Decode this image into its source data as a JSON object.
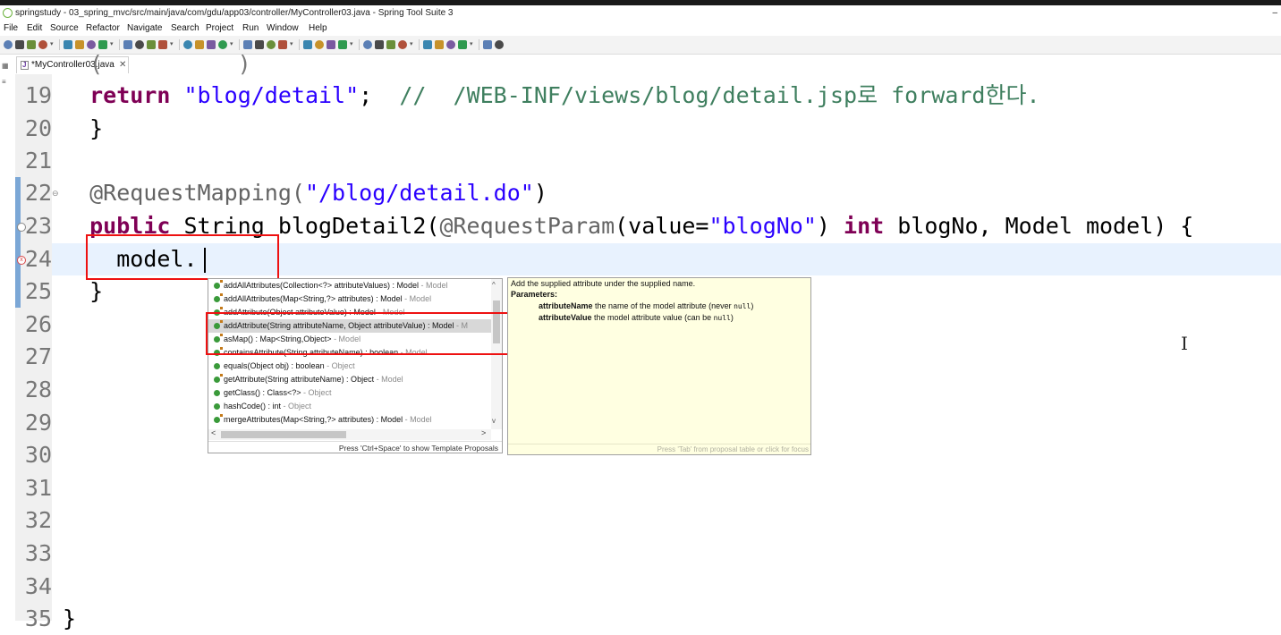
{
  "window": {
    "title": "springstudy - 03_spring_mvc/src/main/java/com/gdu/app03/controller/MyController03.java - Spring Tool Suite 3",
    "minimize": "–"
  },
  "menu": [
    "File",
    "Edit",
    "Source",
    "Refactor",
    "Navigate",
    "Search",
    "Project",
    "Run",
    "Window",
    "Help"
  ],
  "toolbar_icons": [
    "new-icon",
    "save-icon",
    "save-all-icon",
    "print-icon",
    "toggle-icon",
    "select-icon",
    "debug-icon",
    "refresh-icon",
    "pin-icon",
    "highlight-icon",
    "block-icon",
    "list-icon",
    "pilcrow-icon",
    "arrows-icon",
    "bug-icon",
    "run-icon",
    "run-config-icon",
    "stop-icon",
    "deploy-icon",
    "search-icon",
    "tasks-icon",
    "gear-icon",
    "open-folder-icon",
    "build-icon",
    "brush-icon",
    "marker-icon",
    "globe-icon",
    "down-icon",
    "up-icon",
    "back-icon",
    "forward-icon",
    "nav-back-icon",
    "nav-forward-icon",
    "pin-editor-icon"
  ],
  "editor_tab": {
    "label": "*MyController03.java",
    "close": "✕"
  },
  "editor": {
    "line_numbers": [
      "19",
      "20",
      "21",
      "22",
      "23",
      "24",
      "25",
      "26",
      "27",
      "28",
      "29",
      "30",
      "31",
      "32",
      "33",
      "34",
      "35"
    ],
    "partial_top_line": "(          )",
    "line19": {
      "kw": "return",
      "str": "\"blog/detail\"",
      "sep": ";",
      "cmt": "//  /WEB-INF/views/blog/detail.jsp로 forward한다."
    },
    "line20": "}",
    "line22": {
      "ann": "@RequestMapping(",
      "str": "\"/blog/detail.do\"",
      "end": ")"
    },
    "line23": {
      "kw": "public",
      "t1": " String blogDetail2(",
      "ann": "@RequestParam",
      "t2": "(value=",
      "str": "\"blogNo\"",
      "t3": ") ",
      "kw2": "int",
      "t4": " blogNo, Model model) {"
    },
    "line24": "model.",
    "line25": "}",
    "line35": "}"
  },
  "proposals": {
    "items": [
      {
        "text": "addAllAttributes(Collection<?> attributeValues) : Model",
        "owner": " - Model",
        "selected": false
      },
      {
        "text": "addAllAttributes(Map<String,?> attributes) : Model",
        "owner": " - Model",
        "selected": false
      },
      {
        "text": "addAttribute(Object attributeValue) : Model",
        "owner": " - Model",
        "selected": false
      },
      {
        "text": "addAttribute(String attributeName, Object attributeValue) : Model",
        "owner": " - M",
        "selected": true
      },
      {
        "text": "asMap() : Map<String,Object>",
        "owner": " - Model",
        "selected": false
      },
      {
        "text": "containsAttribute(String attributeName) : boolean",
        "owner": " - Model",
        "selected": false
      },
      {
        "text": "equals(Object obj) : boolean",
        "owner": " - Object",
        "selected": false
      },
      {
        "text": "getAttribute(String attributeName) : Object",
        "owner": " - Model",
        "selected": false
      },
      {
        "text": "getClass() : Class<?>",
        "owner": " - Object",
        "selected": false
      },
      {
        "text": "hashCode() : int",
        "owner": " - Object",
        "selected": false
      },
      {
        "text": "mergeAttributes(Map<String,?> attributes) : Model",
        "owner": " - Model",
        "selected": false
      }
    ],
    "footer": "Press 'Ctrl+Space' to show Template Proposals",
    "scroll_left": "<",
    "scroll_right": ">",
    "scroll_up": "^",
    "scroll_down": "v"
  },
  "doc": {
    "desc": "Add the supplied attribute under the supplied name.",
    "params_heading": "Parameters:",
    "p1_name": "attributeName",
    "p1_desc": " the name of the model attribute (never ",
    "p1_code": "null",
    "p1_end": ")",
    "p2_name": "attributeValue",
    "p2_desc": " the model attribute value (can be ",
    "p2_code": "null",
    "p2_end": ")",
    "footer": "Press 'Tab' from proposal table or click for focus"
  },
  "colors": {
    "keyword": "#7f0055",
    "string": "#2a00ff",
    "comment": "#3f7f5f",
    "annotation": "#646464",
    "highlight_box": "#ee1111",
    "current_line": "#e8f2fe",
    "doc_bg": "#ffffe1"
  },
  "cursor_icon": "I"
}
